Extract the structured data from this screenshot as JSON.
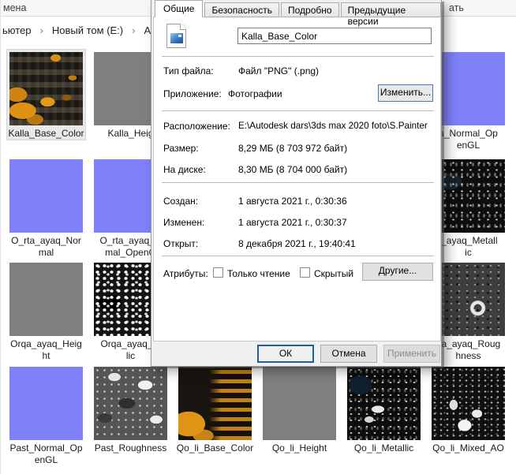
{
  "explorer": {
    "toolbar_left_partial": "мена",
    "toolbar_right_partial": "ать",
    "breadcrumb": [
      "ьютер",
      "Новый том (E:)",
      "Auto"
    ],
    "crumb_separator": "›"
  },
  "dialog": {
    "tabs": [
      "Общие",
      "Безопасность",
      "Подробно",
      "Предыдущие версии"
    ],
    "active_tab": "Общие",
    "file_name": "Kalla_Base_Color",
    "rows": {
      "type": {
        "label": "Тип файла:",
        "value": "Файл \"PNG\" (.png)"
      },
      "app": {
        "label": "Приложение:",
        "value": "Фотографии",
        "button": "Изменить..."
      },
      "location": {
        "label": "Расположение:",
        "value": "E:\\Autodesk dars\\3ds max 2020 foto\\S.Painter"
      },
      "size": {
        "label": "Размер:",
        "value": "8,29 МБ (8 703 972 байт)"
      },
      "disk": {
        "label": "На диске:",
        "value": "8,30 МБ (8 704 000 байт)"
      },
      "created": {
        "label": "Создан:",
        "value": "1 августа 2021 г., 0:30:36"
      },
      "modified": {
        "label": "Изменен:",
        "value": "1 августа 2021 г., 0:30:37"
      },
      "opened": {
        "label": "Открыт:",
        "value": "8 декабря 2021 г., 19:40:41"
      },
      "attributes": {
        "label": "Атрибуты:",
        "readonly": "Только чтение",
        "hidden": "Скрытый",
        "button": "Другие...",
        "readonly_checked": false,
        "hidden_checked": false
      }
    },
    "buttons": {
      "ok": "ОК",
      "cancel": "Отмена",
      "apply": "Применить",
      "apply_disabled": true
    }
  },
  "tiles": [
    {
      "label": "Kalla_Base_Color",
      "texture": "basecolor",
      "row": 1,
      "col": 1,
      "selected": true
    },
    {
      "label": "Kalla_Heig",
      "texture": "gray",
      "row": 1,
      "col": 2
    },
    {
      "label": "a_Normal_Op\nenGL",
      "texture": "normal",
      "row": 1,
      "col": 6
    },
    {
      "label": "",
      "texture": "normal",
      "row": 1,
      "col": 7
    },
    {
      "label": "O_rta_ayaq_Nor\nmal",
      "texture": "normal",
      "row": 2,
      "col": 1
    },
    {
      "label": "O_rta_ayaq_N\nmal_OpenG",
      "texture": "normal",
      "row": 2,
      "col": 2
    },
    {
      "label": "i_ayaq_Metall\nic",
      "texture": "metaldark",
      "row": 2,
      "col": 6
    },
    {
      "label": "",
      "texture": "metaldark",
      "row": 2,
      "col": 7
    },
    {
      "label": "Orqa_ayaq_Heig\nht",
      "texture": "gray",
      "row": 3,
      "col": 1
    },
    {
      "label": "Orqa_ayaq_M\nlic",
      "texture": "bwnoise",
      "row": 3,
      "col": 2
    },
    {
      "label": "qa_ayaq_Roug\nhness",
      "texture": "roughdark",
      "row": 3,
      "col": 6
    },
    {
      "label": "",
      "texture": "gray",
      "row": 3,
      "col": 7
    },
    {
      "label": "Past_Normal_Op\nenGL",
      "texture": "normal",
      "row": 4,
      "col": 1
    },
    {
      "label": "Past_Roughness",
      "texture": "roughgray",
      "row": 4,
      "col": 2
    },
    {
      "label": "Qo_li_Base_Color",
      "texture": "basecolor2",
      "row": 4,
      "col": 3
    },
    {
      "label": "Qo_li_Height",
      "texture": "gray",
      "row": 4,
      "col": 4
    },
    {
      "label": "Qo_li_Metallic",
      "texture": "metaldark2",
      "row": 4,
      "col": 5
    },
    {
      "label": "Qo_li_Mixed_AO",
      "texture": "mixedao",
      "row": 4,
      "col": 6
    },
    {
      "label": "",
      "texture": "gray",
      "row": 4,
      "col": 7
    }
  ],
  "colors": {
    "normal_map": "#8080fb",
    "height_map": "#7f7f7f",
    "selection_bg": "#e9e9e9",
    "focus_blue": "#1f5ca0",
    "dialog_bg": "#f0f0f0"
  }
}
